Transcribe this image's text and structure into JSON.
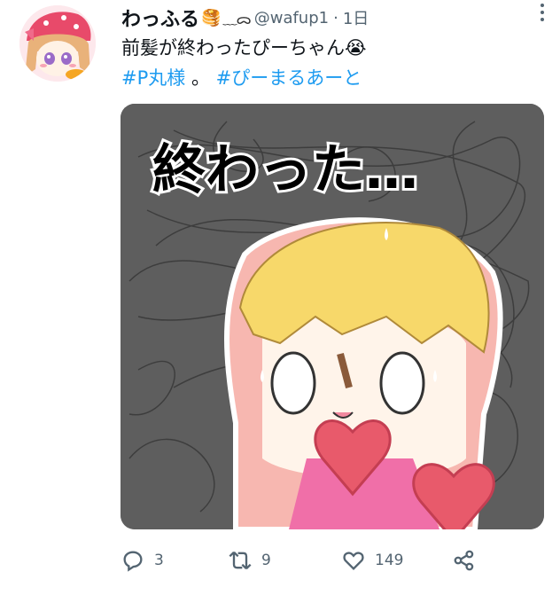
{
  "tweet": {
    "display_name": "わっふる",
    "name_emoji": "🥞",
    "name_decoration": "﹏ᯅ",
    "handle": "@wafup1",
    "separator": "·",
    "time": "1日",
    "text": "前髪が終わったぴーちゃん😭",
    "hashtags": [
      "#P丸様",
      "#ぴーまるあーと"
    ],
    "hashtag_separator": " 。",
    "media": {
      "caption_text": "終わった…",
      "alt_icons": [
        "heart-sticker",
        "heart-sticker"
      ]
    }
  },
  "actions": {
    "reply_count": "3",
    "retweet_count": "9",
    "like_count": "149"
  },
  "colors": {
    "accent": "#1d9bf0",
    "muted": "#536471",
    "text": "#0f1419",
    "media_bg": "#5e5e5e",
    "heart": "#e85a6b",
    "hair": "#f7d86a"
  }
}
